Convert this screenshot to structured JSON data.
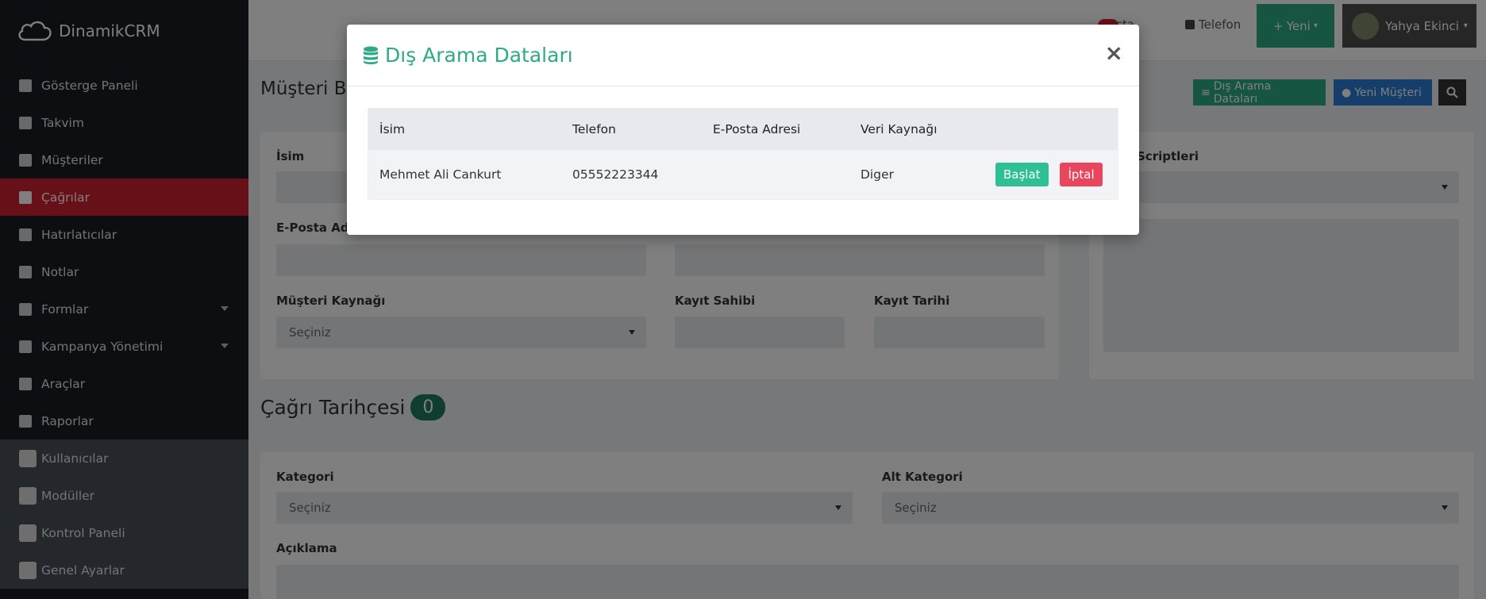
{
  "app": {
    "brand": "DinamikCRM"
  },
  "sidebar": {
    "items": [
      {
        "label": "Gösterge Paneli",
        "icon": "dashboard-icon"
      },
      {
        "label": "Takvim",
        "icon": "calendar-icon"
      },
      {
        "label": "Müşteriler",
        "icon": "users-icon"
      },
      {
        "label": "Çağrılar",
        "icon": "phone-icon",
        "active": true
      },
      {
        "label": "Hatırlatıcılar",
        "icon": "bell-icon"
      },
      {
        "label": "Notlar",
        "icon": "note-icon"
      },
      {
        "label": "Formlar",
        "icon": "file-icon",
        "has_submenu": true
      },
      {
        "label": "Kampanya Yönetimi",
        "icon": "campaign-icon",
        "has_submenu": true
      },
      {
        "label": "Araçlar",
        "icon": "wrench-icon"
      },
      {
        "label": "Raporlar",
        "icon": "chart-icon"
      }
    ],
    "admin_items": [
      {
        "label": "Kullanıcılar",
        "icon": "user-icon"
      },
      {
        "label": "Modüller",
        "icon": "cube-icon"
      },
      {
        "label": "Kontrol Paneli",
        "icon": "settings-icon"
      },
      {
        "label": "Genel Ayarlar",
        "icon": "gear-icon"
      }
    ]
  },
  "topbar": {
    "email_label": "sta",
    "phone_label": "Telefon",
    "new_button": "Yeni",
    "user_name": "Yahya Ekinci"
  },
  "page": {
    "title": "Müşteri Bi",
    "actions": {
      "external_data": "Dış Arama Dataları",
      "new_customer": "Yeni Müşteri"
    },
    "form": {
      "name_label": "İsim",
      "email_label": "E-Posta Adre",
      "source_label": "Müşteri Kaynağı",
      "source_value": "Seçiniz",
      "owner_label": "Kayıt Sahibi",
      "date_label": "Kayıt Tarihi",
      "scripts_label": "Scriptleri"
    },
    "history": {
      "title": "Çağrı Tarihçesi",
      "count": "0",
      "category_label": "Kategori",
      "category_value": "Seçiniz",
      "subcategory_label": "Alt Kategori",
      "subcategory_value": "Seçiniz",
      "description_label": "Açıklama"
    }
  },
  "modal": {
    "title": "Dış Arama Dataları",
    "close": "×",
    "columns": [
      "İsim",
      "Telefon",
      "E-Posta Adresi",
      "Veri Kaynağı"
    ],
    "rows": [
      {
        "name": "Mehmet Ali Cankurt",
        "phone": "05552223344",
        "email": "",
        "source": "Diger"
      }
    ],
    "start_button": "Başlat",
    "cancel_button": "İptal"
  },
  "colors": {
    "accent_green": "#2eaa86",
    "active_red": "#d0202f",
    "blue": "#2a7fd4",
    "cancel_red": "#e9455c"
  }
}
